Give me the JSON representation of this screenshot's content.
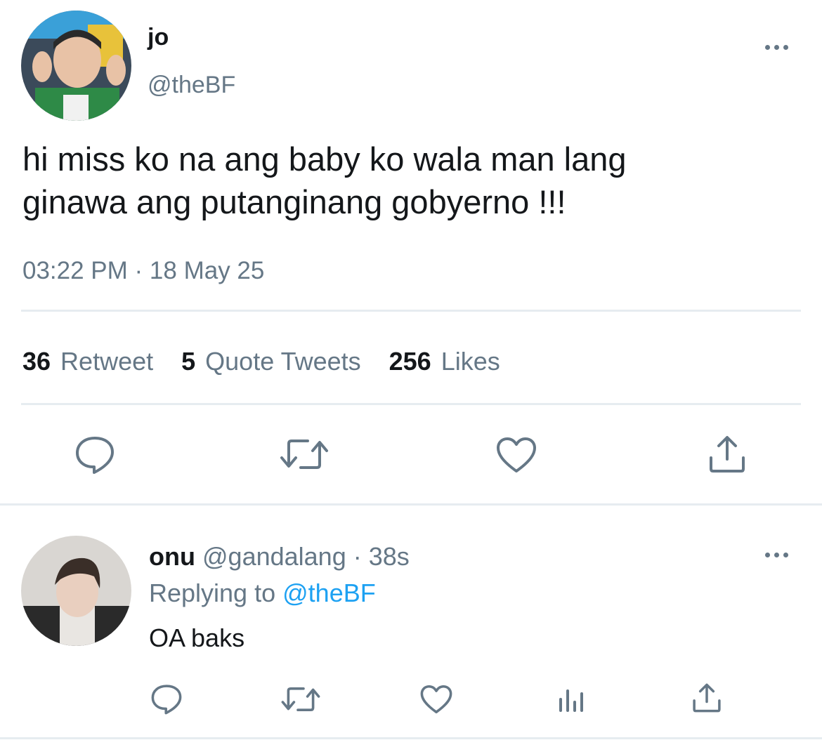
{
  "main_tweet": {
    "display_name": "jo",
    "handle": "@theBF",
    "text": "hi miss ko na ang baby ko wala man lang ginawa ang putanginang gobyerno !!!",
    "timestamp": "03:22 PM · 18 May 25",
    "stats": {
      "retweets_count": "36",
      "retweets_label": "Retweet",
      "quotes_count": "5",
      "quotes_label": "Quote Tweets",
      "likes_count": "256",
      "likes_label": "Likes"
    },
    "actions": [
      "reply-icon",
      "retweet-icon",
      "like-icon",
      "share-icon"
    ]
  },
  "reply": {
    "display_name": "onu",
    "handle": "@gandalang",
    "time": "38s",
    "replying_prefix": "Replying to",
    "replying_handle": "@theBF",
    "text": "OA baks",
    "actions": [
      "reply-icon",
      "retweet-icon",
      "like-icon",
      "analytics-icon",
      "share-icon"
    ]
  },
  "colors": {
    "text": "#14171a",
    "secondary": "#657786",
    "link": "#1da1f2",
    "divider": "#e6ecf0"
  }
}
